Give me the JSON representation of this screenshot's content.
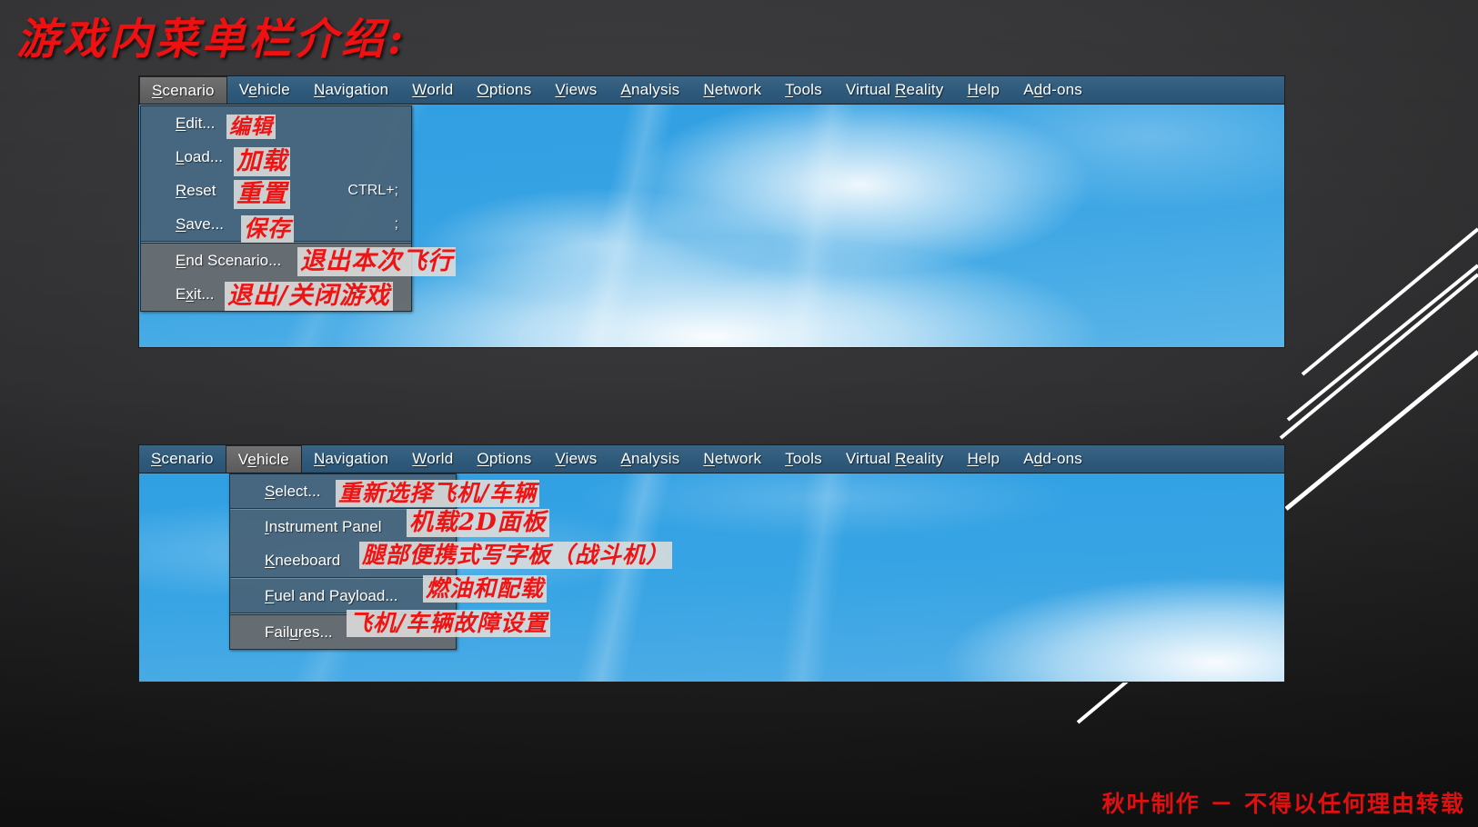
{
  "slide": {
    "title": "游戏内菜单栏介绍:",
    "footer": "秋叶制作 － 不得以任何理由转载",
    "accent_red": "#ee1414",
    "background_dark": "#303032",
    "sky_blue": "#35a2e3",
    "menubar_blue": "#2f5b7c",
    "menu_active_grey": "#646464"
  },
  "menubar": {
    "items": [
      {
        "pre": "",
        "mnemonic": "S",
        "post": "cenario"
      },
      {
        "pre": "V",
        "mnemonic": "e",
        "post": "hicle"
      },
      {
        "pre": "",
        "mnemonic": "N",
        "post": "avigation"
      },
      {
        "pre": "",
        "mnemonic": "W",
        "post": "orld"
      },
      {
        "pre": "",
        "mnemonic": "O",
        "post": "ptions"
      },
      {
        "pre": "",
        "mnemonic": "V",
        "post": "iews"
      },
      {
        "pre": "",
        "mnemonic": "A",
        "post": "nalysis"
      },
      {
        "pre": "",
        "mnemonic": "N",
        "post": "etwork"
      },
      {
        "pre": "",
        "mnemonic": "T",
        "post": "ools"
      },
      {
        "pre": "Virtual ",
        "mnemonic": "R",
        "post": "eality"
      },
      {
        "pre": "",
        "mnemonic": "H",
        "post": "elp"
      },
      {
        "pre": "A",
        "mnemonic": "d",
        "post": "d-ons"
      }
    ]
  },
  "shot1": {
    "active_menu": "Scenario",
    "menu_title": "Scenario",
    "dropdown": {
      "group_upper": [
        {
          "pre": "",
          "mnemonic": "E",
          "post": "dit...",
          "accel": "",
          "anno": "编辑"
        },
        {
          "pre": "",
          "mnemonic": "L",
          "post": "oad...",
          "accel": "",
          "anno": "加载"
        },
        {
          "pre": "",
          "mnemonic": "R",
          "post": "eset",
          "accel": "CTRL+;",
          "anno": "重置"
        },
        {
          "pre": "",
          "mnemonic": "S",
          "post": "ave...",
          "accel": ";",
          "anno": "保存"
        }
      ],
      "group_lower": [
        {
          "pre": "",
          "mnemonic": "E",
          "post": "nd Scenario...",
          "accel": "",
          "anno": "退出本次飞行"
        },
        {
          "pre": "E",
          "mnemonic": "x",
          "post": "it...",
          "accel": "",
          "anno": "退出/关闭游戏"
        }
      ]
    }
  },
  "shot2": {
    "active_menu": "Vehicle",
    "menu_title": "Vehicle",
    "dropdown": {
      "group_upper": [
        {
          "pre": "",
          "mnemonic": "S",
          "post": "elect...",
          "accel": "",
          "anno": "重新选择飞机/车辆"
        }
      ],
      "group_middle": [
        {
          "pre": "",
          "mnemonic": "I",
          "post": "nstrument Panel",
          "accel": "",
          "anno": "机载2D面板"
        },
        {
          "pre": "",
          "mnemonic": "K",
          "post": "neeboard",
          "accel": "",
          "anno": "腿部便携式写字板（战斗机）"
        }
      ],
      "group_lower2": [
        {
          "pre": "",
          "mnemonic": "F",
          "post": "uel and Payload...",
          "accel": "",
          "anno": "燃油和配载"
        }
      ],
      "group_lower3": [
        {
          "pre": "Fail",
          "mnemonic": "u",
          "post": "res...",
          "accel": "",
          "anno": "飞机/车辆故障设置"
        }
      ]
    }
  }
}
